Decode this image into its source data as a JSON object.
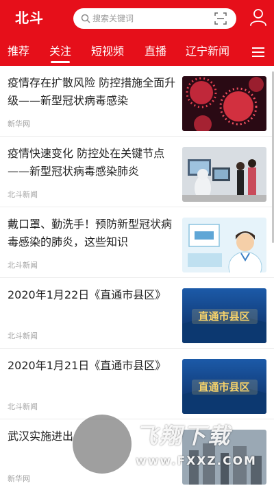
{
  "app": {
    "logo": "北斗"
  },
  "search": {
    "placeholder": "搜索关键词"
  },
  "tabs": [
    {
      "label": "推荐",
      "active": false
    },
    {
      "label": "关注",
      "active": true
    },
    {
      "label": "短视频",
      "active": false
    },
    {
      "label": "直播",
      "active": false
    },
    {
      "label": "辽宁新闻",
      "active": false
    }
  ],
  "colors": {
    "brand_red": "#e60f1a"
  },
  "icons": {
    "search": "search-icon",
    "scan": "scan-icon",
    "user": "user-icon",
    "menu": "menu-icon"
  },
  "feed": [
    {
      "title": "疫情存在扩散风险 防控措施全面升级——新型冠状病毒感染",
      "source": "新华网",
      "thumb": "virus"
    },
    {
      "title": "疫情快速变化 防控处在关键节点——新型冠状病毒感染肺炎",
      "source": "北斗新闻",
      "thumb": "lab"
    },
    {
      "title": "戴口罩、勤洗手！预防新型冠状病毒感染的肺炎，这些知识",
      "source": "北斗新闻",
      "thumb": "doctor"
    },
    {
      "title": "2020年1月22日《直通市县区》",
      "source": "北斗新闻",
      "thumb": "show",
      "thumb_text": "直通市县区"
    },
    {
      "title": "2020年1月21日《直通市县区》",
      "source": "北斗新闻",
      "thumb": "show",
      "thumb_text": "直通市县区"
    },
    {
      "title": "武汉实施进出",
      "source": "新华网",
      "thumb": "city"
    }
  ],
  "watermark": {
    "text": "飞翔下载",
    "url": "www.FXXZ.COM"
  }
}
